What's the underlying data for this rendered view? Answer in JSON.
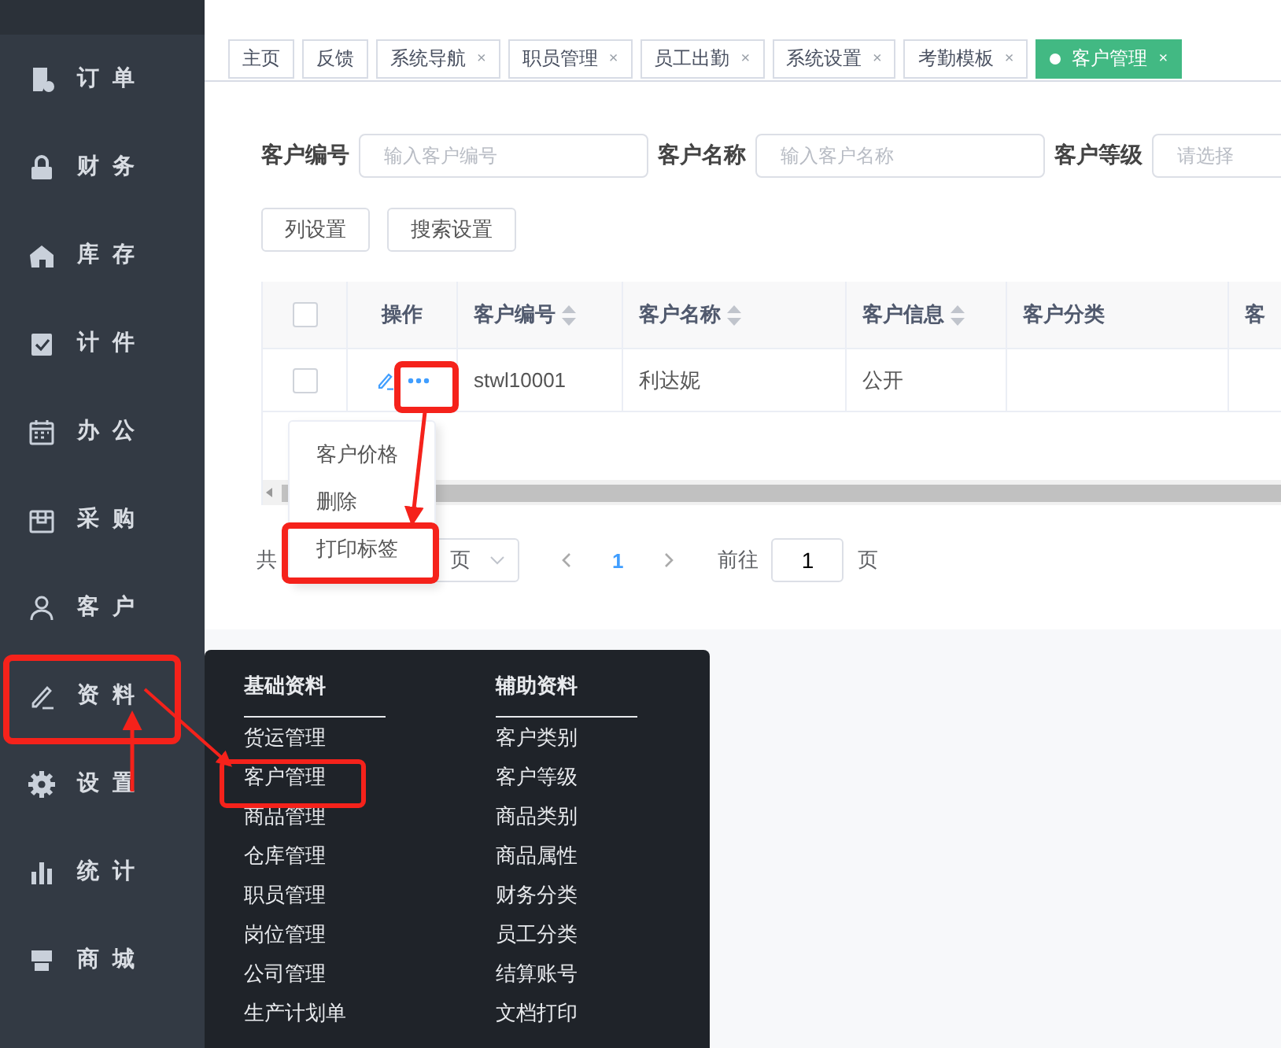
{
  "sidebar": {
    "items": [
      {
        "label": "订单",
        "selected": false
      },
      {
        "label": "财务",
        "selected": false
      },
      {
        "label": "库存",
        "selected": false
      },
      {
        "label": "计件",
        "selected": false
      },
      {
        "label": "办公",
        "selected": false
      },
      {
        "label": "采购",
        "selected": false
      },
      {
        "label": "客户",
        "selected": false
      },
      {
        "label": "资料",
        "selected": false
      },
      {
        "label": "设置",
        "selected": false
      },
      {
        "label": "统计",
        "selected": false
      },
      {
        "label": "商城",
        "selected": false
      }
    ]
  },
  "tabs": [
    {
      "label": "主页",
      "selected": false
    },
    {
      "label": "反馈",
      "selected": false
    },
    {
      "label": "系统导航",
      "close": "×",
      "selected": false
    },
    {
      "label": "职员管理",
      "close": "×",
      "selected": false
    },
    {
      "label": "员工出勤",
      "close": "×",
      "selected": false
    },
    {
      "label": "系统设置",
      "close": "×",
      "selected": false
    },
    {
      "label": "考勤模板",
      "close": "×",
      "selected": false
    },
    {
      "label": "客户管理",
      "close": "×",
      "selected": true
    }
  ],
  "search": {
    "fields": [
      {
        "label": "客户编号",
        "placeholder": "输入客户编号"
      },
      {
        "label": "客户名称",
        "placeholder": "输入客户名称"
      },
      {
        "label": "客户等级",
        "placeholder": "请选择"
      }
    ],
    "buttons": [
      "列设置",
      "搜索设置"
    ]
  },
  "table": {
    "header_checked": false,
    "columns": [
      {
        "label": "操作",
        "sortable": false
      },
      {
        "label": "客户编号",
        "sortable": true
      },
      {
        "label": "客户名称",
        "sortable": true
      },
      {
        "label": "客户信息",
        "sortable": true
      },
      {
        "label": "客户分类",
        "sortable": false
      },
      {
        "label": "客",
        "sortable": false
      }
    ],
    "rows": [
      {
        "checked": false,
        "cells": [
          "",
          "stwl10001",
          "利达妮",
          "公开"
        ]
      }
    ]
  },
  "row_menu": {
    "items": [
      "客户价格",
      "删除",
      "打印标签"
    ]
  },
  "pagination": {
    "total_text": "共",
    "page_size_text": "页",
    "pages": [
      {
        "label": "1",
        "selected": true
      }
    ],
    "goto_label": "前往",
    "goto_value": "1",
    "goto_suffix": "页"
  },
  "mega_menu": {
    "columns": [
      {
        "heading": "基础资料",
        "items": [
          "货运管理",
          "客户管理",
          "商品管理",
          "仓库管理",
          "职员管理",
          "岗位管理",
          "公司管理",
          "生产计划单"
        ]
      },
      {
        "heading": "辅助资料",
        "items": [
          "客户类别",
          "客户等级",
          "商品类别",
          "商品属性",
          "财务分类",
          "员工分类",
          "结算账号",
          "文档打印"
        ]
      }
    ]
  }
}
